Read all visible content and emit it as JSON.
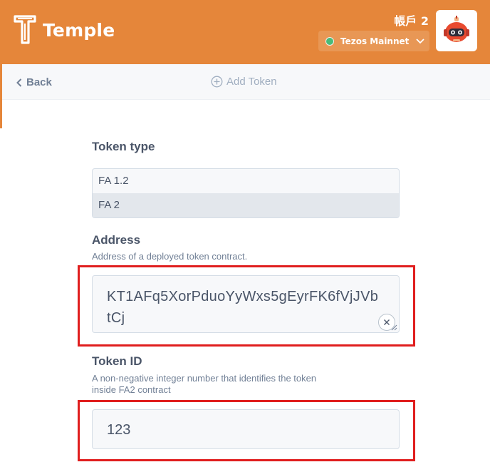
{
  "app": {
    "name": "Temple"
  },
  "header": {
    "account_name": "帳戶 2",
    "network": {
      "label": "Tezos Mainnet",
      "status_color": "#48bb78"
    },
    "brand_color": "#e5863a"
  },
  "page": {
    "back_label": "Back",
    "title": "Add Token"
  },
  "form": {
    "token_type": {
      "label": "Token type",
      "options": [
        "FA 1.2",
        "FA 2"
      ],
      "selected": "FA 2"
    },
    "address": {
      "label": "Address",
      "description": "Address of a deployed token contract.",
      "value": "KT1AFq5XorPduoYyWxs5gEyrFK6fVjJVbtCj"
    },
    "token_id": {
      "label": "Token ID",
      "description_line1": "A non-negative integer number that identifies the token",
      "description_line2": "inside FA2 contract",
      "value": "123"
    }
  },
  "highlight_color": "#e01e1e"
}
